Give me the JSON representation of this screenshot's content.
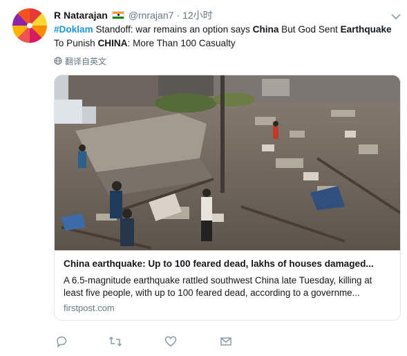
{
  "tweet": {
    "author_name": "R Natarajan",
    "author_handle": "@rnrajan7",
    "separator": "·",
    "time": "12小时",
    "text_parts": {
      "hashtag": "#Doklam",
      "t1": " Standoff: war remains an option says ",
      "b1": "China",
      "t2": " But God Sent ",
      "b2": "Earthquake",
      "t3": " To Punish ",
      "b3": "CHINA",
      "t4": ": More Than 100 Casualty"
    },
    "translate_label": "翻译自英文"
  },
  "card": {
    "title": "China earthquake: Up to 100 feared dead, lakhs of houses damaged...",
    "description": "A 6.5-magnitude earthquake rattled southwest China late Tuesday, killing at least five people, with up to 100 feared dead, according to a governme...",
    "domain": "firstpost.com"
  },
  "icons": {
    "avatar": "pinwheel-avatar",
    "flag": "india-flag-icon",
    "caret": "chevron-down-icon",
    "translate": "globe-icon",
    "reply": "reply-icon",
    "retweet": "retweet-icon",
    "like": "heart-icon",
    "dm": "envelope-icon"
  },
  "colors": {
    "link": "#1b95e0",
    "secondary_text": "#657786",
    "border": "#e1e8ed",
    "icon": "#8899a6"
  }
}
